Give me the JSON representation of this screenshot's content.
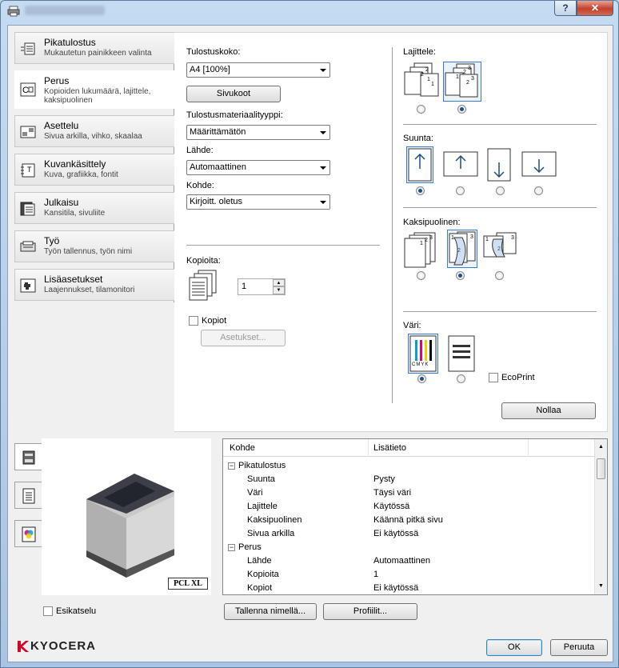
{
  "window": {
    "help_label": "?",
    "close_label": "✕"
  },
  "nav": [
    {
      "title": "Pikatulostus",
      "sub": "Mukautetun painikkeen valinta",
      "icon": "quick-print-icon"
    },
    {
      "title": "Perus",
      "sub": "Kopioiden lukumäärä, lajittele, kaksipuolinen",
      "icon": "basic-icon"
    },
    {
      "title": "Asettelu",
      "sub": "Sivua arkilla, vihko, skaalaa",
      "icon": "layout-icon"
    },
    {
      "title": "Kuvankäsittely",
      "sub": "Kuva, grafiikka, fontit",
      "icon": "imaging-icon"
    },
    {
      "title": "Julkaisu",
      "sub": "Kansitila, sivuliite",
      "icon": "publishing-icon"
    },
    {
      "title": "Työ",
      "sub": "Työn tallennus, työn nimi",
      "icon": "job-icon"
    },
    {
      "title": "Lisäasetukset",
      "sub": "Laajennukset, tilamonitori",
      "icon": "advanced-icon"
    }
  ],
  "basic": {
    "print_size_label": "Tulostuskoko:",
    "print_size_value": "A4  [100%]",
    "page_sizes_button": "Sivukoot",
    "media_type_label": "Tulostusmateriaalityyppi:",
    "media_type_value": "Määrittämätön",
    "source_label": "Lähde:",
    "source_value": "Automaattinen",
    "destination_label": "Kohde:",
    "destination_value": "Kirjoitt. oletus",
    "copies_label": "Kopioita:",
    "copies_value": "1",
    "collate_copies_label": "Kopiot",
    "settings_button": "Asetukset..."
  },
  "right": {
    "collate_label": "Lajittele:",
    "orientation_label": "Suunta:",
    "duplex_label": "Kaksipuolinen:",
    "color_label": "Väri:",
    "ecoprint_label": "EcoPrint",
    "reset_button": "Nollaa",
    "cmyk_label": "CMYK"
  },
  "preview": {
    "pdl_label": "PCL XL",
    "preview_label": "Esikatselu"
  },
  "grid": {
    "col1": "Kohde",
    "col2": "Lisätieto",
    "rows": [
      {
        "k": "Pikatulostus",
        "v": "",
        "group": true
      },
      {
        "k": "Suunta",
        "v": "Pysty"
      },
      {
        "k": "Väri",
        "v": "Täysi väri"
      },
      {
        "k": "Lajittele",
        "v": "Käytössä"
      },
      {
        "k": "Kaksipuolinen",
        "v": "Käännä pitkä sivu"
      },
      {
        "k": "Sivua arkilla",
        "v": "Ei käytössä"
      },
      {
        "k": "Perus",
        "v": "",
        "group": true
      },
      {
        "k": "Lähde",
        "v": "Automaattinen"
      },
      {
        "k": "Kopioita",
        "v": "1"
      },
      {
        "k": "Kopiot",
        "v": "Ei käytössä"
      }
    ]
  },
  "footer": {
    "save_as_button": "Tallenna nimellä...",
    "profiles_button": "Profiilit...",
    "ok_button": "OK",
    "cancel_button": "Peruuta",
    "brand": "KYOCERA"
  }
}
